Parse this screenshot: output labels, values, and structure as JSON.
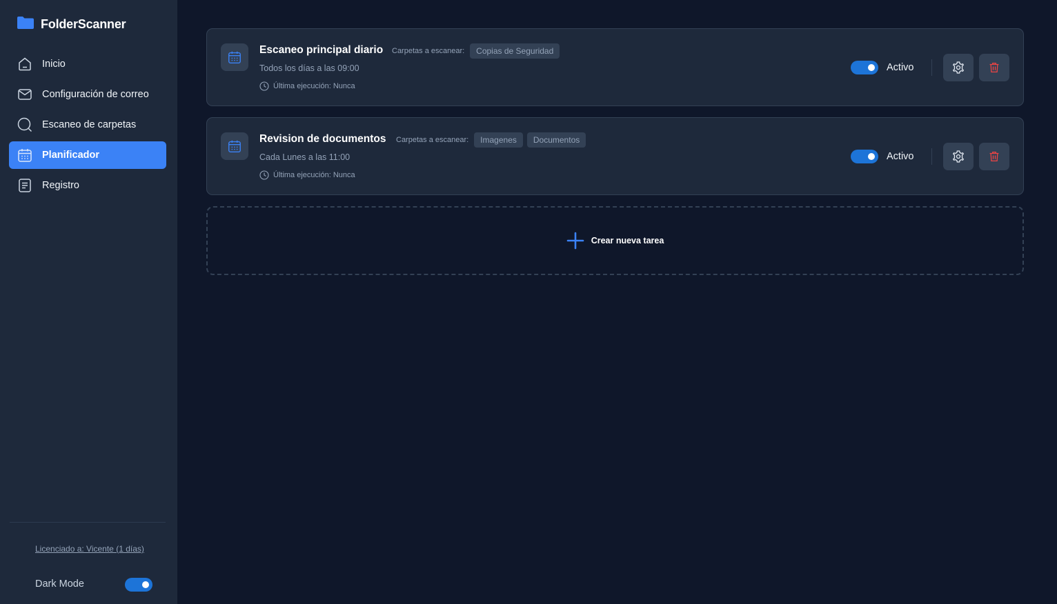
{
  "app": {
    "title": "FolderScanner"
  },
  "colors": {
    "accent": "#3b82f6",
    "toggle": "#1d74d8",
    "delete": "#ef4444",
    "sidebar_bg": "#1e293b",
    "main_bg": "#0f172a"
  },
  "sidebar": {
    "items": [
      {
        "label": "Inicio",
        "icon": "home-icon",
        "active": false
      },
      {
        "label": "Configuración de correo",
        "icon": "mail-icon",
        "active": false
      },
      {
        "label": "Escaneo de carpetas",
        "icon": "search-icon",
        "active": false
      },
      {
        "label": "Planificador",
        "icon": "calendar-icon",
        "active": true
      },
      {
        "label": "Registro",
        "icon": "document-icon",
        "active": false
      }
    ],
    "license": "Licenciado a: Vicente (1 días)",
    "dark_mode": {
      "label": "Dark Mode",
      "enabled": true
    }
  },
  "tasks": [
    {
      "title": "Escaneo principal diario",
      "folders_label": "Carpetas a escanear:",
      "folders": [
        "Copias de Seguridad"
      ],
      "schedule": "Todos los días a las 09:00",
      "last_run": "Última ejecución: Nunca",
      "status_label": "Activo",
      "enabled": true
    },
    {
      "title": "Revision de documentos",
      "folders_label": "Carpetas a escanear:",
      "folders": [
        "Imagenes",
        "Documentos"
      ],
      "schedule": "Cada Lunes a las 11:00",
      "last_run": "Última ejecución: Nunca",
      "status_label": "Activo",
      "enabled": true
    }
  ],
  "create_task": {
    "label": "Crear nueva tarea"
  }
}
